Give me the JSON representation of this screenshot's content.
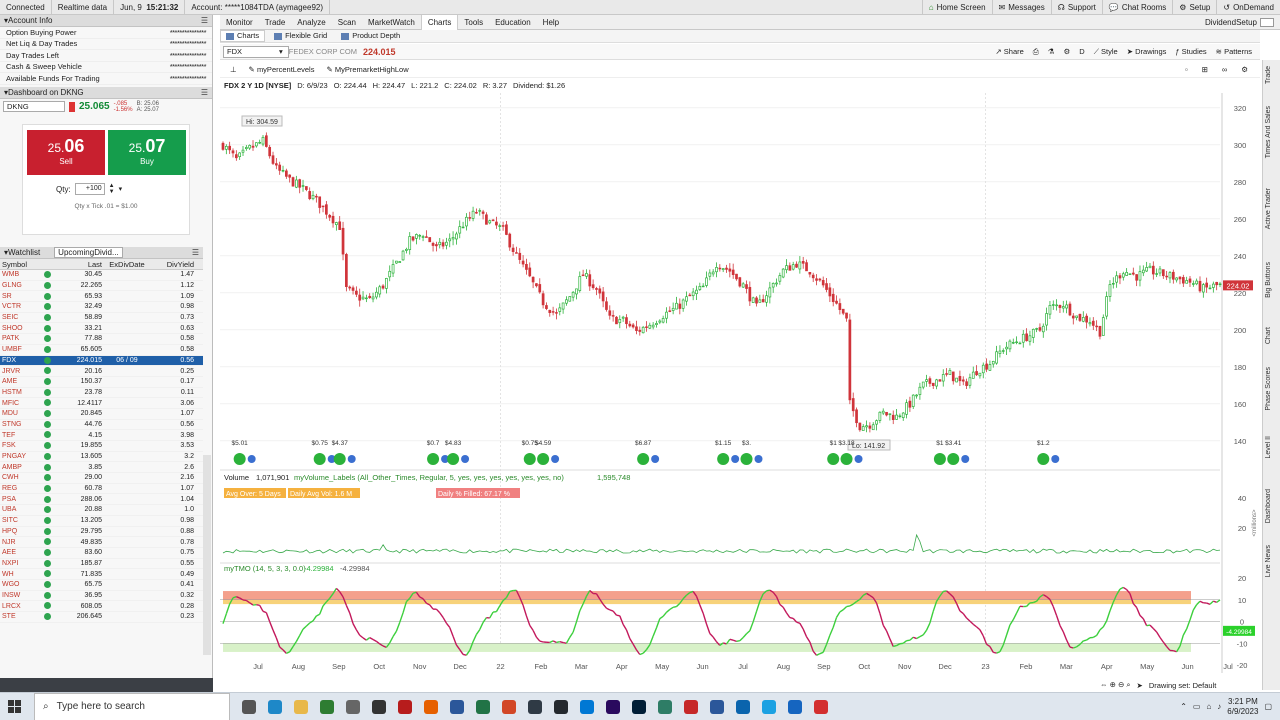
{
  "status": {
    "connected": "Connected",
    "realtime": "Realtime data",
    "date": "Jun, 9",
    "time": "15:21:32",
    "account_label": "Account:",
    "account": "*****1084TDA (aymagee92)",
    "home_screen": "Home Screen",
    "messages": "Messages",
    "support": "Support",
    "chat_rooms": "Chat Rooms",
    "setup": "Setup",
    "ondemand": "OnDemand"
  },
  "account_info": {
    "title": "Account Info",
    "rows": [
      {
        "label": "Option Buying Power",
        "value": "***************"
      },
      {
        "label": "Net Liq & Day Trades",
        "value": "***************"
      },
      {
        "label": "Day Trades Left",
        "value": "***************"
      },
      {
        "label": "Cash & Sweep Vehicle",
        "value": "***************"
      },
      {
        "label": "Available Funds For Trading",
        "value": "***************"
      }
    ]
  },
  "dashboard": {
    "title": "Dashboard on DKNG",
    "symbol": "DKNG",
    "last": "25.065",
    "change1": "-.085",
    "change2": "-1.56%",
    "bid_ask1": "B: 25.06",
    "bid_ask2": "A: 25.07",
    "sell_prefix": "25.",
    "sell_suffix": "06",
    "sell_label": "Sell",
    "buy_prefix": "25.",
    "buy_suffix": "07",
    "buy_label": "Buy",
    "qty_label": "Qty:",
    "qty_value": "+100",
    "tick_note": "Qty x Tick .01 = $1.00",
    "sell_color": "#c8202f",
    "buy_color": "#159d4c"
  },
  "watchlist": {
    "title": "Watchlist",
    "list_name": "UpcomingDivid...",
    "headers": {
      "symbol": "Symbol",
      "last": "Last",
      "exdiv": "ExDivDate",
      "divyield": "DivYield"
    },
    "rows": [
      {
        "symbol": "WMB",
        "last": "30.45",
        "exdiv": "",
        "divyield": "1.47"
      },
      {
        "symbol": "GLNG",
        "last": "22.265",
        "exdiv": "",
        "divyield": "1.12"
      },
      {
        "symbol": "SR",
        "last": "65.93",
        "exdiv": "",
        "divyield": "1.09"
      },
      {
        "symbol": "VCTR",
        "last": "32.49",
        "exdiv": "",
        "divyield": "0.98"
      },
      {
        "symbol": "SEIC",
        "last": "58.89",
        "exdiv": "",
        "divyield": "0.73"
      },
      {
        "symbol": "SHOO",
        "last": "33.21",
        "exdiv": "",
        "divyield": "0.63"
      },
      {
        "symbol": "PATK",
        "last": "77.88",
        "exdiv": "",
        "divyield": "0.58"
      },
      {
        "symbol": "UMBF",
        "last": "65.605",
        "exdiv": "",
        "divyield": "0.58"
      },
      {
        "symbol": "FDX",
        "last": "224.015",
        "exdiv": "06 / 09",
        "divyield": "0.56"
      },
      {
        "symbol": "JRVR",
        "last": "20.16",
        "exdiv": "",
        "divyield": "0.25"
      },
      {
        "symbol": "AME",
        "last": "150.37",
        "exdiv": "",
        "divyield": "0.17"
      },
      {
        "symbol": "HSTM",
        "last": "23.78",
        "exdiv": "",
        "divyield": "0.11"
      },
      {
        "symbol": "MFIC",
        "last": "12.4117",
        "exdiv": "",
        "divyield": "3.06"
      },
      {
        "symbol": "MDU",
        "last": "20.845",
        "exdiv": "",
        "divyield": "1.07"
      },
      {
        "symbol": "STNG",
        "last": "44.76",
        "exdiv": "",
        "divyield": "0.56"
      },
      {
        "symbol": "TEF",
        "last": "4.15",
        "exdiv": "",
        "divyield": "3.98"
      },
      {
        "symbol": "FSK",
        "last": "19.855",
        "exdiv": "",
        "divyield": "3.53"
      },
      {
        "symbol": "PNGAY",
        "last": "13.605",
        "exdiv": "",
        "divyield": "3.2"
      },
      {
        "symbol": "AMBP",
        "last": "3.85",
        "exdiv": "",
        "divyield": "2.6"
      },
      {
        "symbol": "CWH",
        "last": "29.00",
        "exdiv": "",
        "divyield": "2.16"
      },
      {
        "symbol": "REG",
        "last": "60.78",
        "exdiv": "",
        "divyield": "1.07"
      },
      {
        "symbol": "PSA",
        "last": "288.06",
        "exdiv": "",
        "divyield": "1.04"
      },
      {
        "symbol": "UBA",
        "last": "20.88",
        "exdiv": "",
        "divyield": "1.0"
      },
      {
        "symbol": "SITC",
        "last": "13.205",
        "exdiv": "",
        "divyield": "0.98"
      },
      {
        "symbol": "HPQ",
        "last": "29.795",
        "exdiv": "",
        "divyield": "0.88"
      },
      {
        "symbol": "NJR",
        "last": "49.835",
        "exdiv": "",
        "divyield": "0.78"
      },
      {
        "symbol": "AEE",
        "last": "83.60",
        "exdiv": "",
        "divyield": "0.75"
      },
      {
        "symbol": "NXPI",
        "last": "185.87",
        "exdiv": "",
        "divyield": "0.55"
      },
      {
        "symbol": "WH",
        "last": "71.835",
        "exdiv": "",
        "divyield": "0.49"
      },
      {
        "symbol": "WGO",
        "last": "65.75",
        "exdiv": "",
        "divyield": "0.41"
      },
      {
        "symbol": "INSW",
        "last": "36.95",
        "exdiv": "",
        "divyield": "0.32"
      },
      {
        "symbol": "LRCX",
        "last": "608.05",
        "exdiv": "",
        "divyield": "0.28"
      },
      {
        "symbol": "STE",
        "last": "206.645",
        "exdiv": "",
        "divyield": "0.23"
      }
    ]
  },
  "nav": {
    "tabs": [
      "Monitor",
      "Trade",
      "Analyze",
      "Scan",
      "MarketWatch",
      "Charts",
      "Tools",
      "Education",
      "Help"
    ],
    "active": "Charts",
    "right_label": "DividendSetup"
  },
  "subtabs": [
    "Charts",
    "Flexible Grid",
    "Product Depth"
  ],
  "chart_toolbar": {
    "symbol": "FDX",
    "company": "FEDEX CORP COM",
    "last": "224.015",
    "share": "Share",
    "style": "Style",
    "drawings": "Drawings",
    "studies": "Studies",
    "patterns": "Patterns"
  },
  "study_bar": {
    "item1": "myPercentLevels",
    "item2": "MyPremarketHighLow"
  },
  "ohlc": {
    "title": "FDX 2 Y 1D [NYSE]",
    "date": "D: 6/9/23",
    "open": "O: 224.44",
    "high": "H: 224.47",
    "low": "L: 221.2",
    "close": "C: 224.02",
    "range": "R: 3.27",
    "dividend": "Dividend: $1.26"
  },
  "chart_data": {
    "type": "candlestick",
    "price_axis": {
      "ticks": [
        140,
        160,
        180,
        200,
        220,
        240,
        260,
        280,
        300,
        320
      ],
      "range": [
        128,
        328
      ]
    },
    "months": [
      "Jul",
      "Aug",
      "Sep",
      "Oct",
      "Nov",
      "Dec",
      "22",
      "Feb",
      "Mar",
      "Apr",
      "May",
      "Jun",
      "Jul",
      "Aug",
      "Sep",
      "Oct",
      "Nov",
      "Dec",
      "23",
      "Feb",
      "Mar",
      "Apr",
      "May",
      "Jun",
      "Jul"
    ],
    "close_path": [
      [
        0,
        300
      ],
      [
        4,
        292
      ],
      [
        8,
        298
      ],
      [
        12,
        302
      ],
      [
        16,
        287
      ],
      [
        20,
        281
      ],
      [
        24,
        276
      ],
      [
        28,
        270
      ],
      [
        32,
        262
      ],
      [
        35,
        256
      ],
      [
        37,
        222
      ],
      [
        40,
        218
      ],
      [
        44,
        216
      ],
      [
        48,
        224
      ],
      [
        52,
        236
      ],
      [
        56,
        248
      ],
      [
        60,
        252
      ],
      [
        64,
        244
      ],
      [
        68,
        248
      ],
      [
        72,
        257
      ],
      [
        76,
        264
      ],
      [
        80,
        258
      ],
      [
        84,
        254
      ],
      [
        88,
        240
      ],
      [
        92,
        228
      ],
      [
        96,
        215
      ],
      [
        100,
        208
      ],
      [
        104,
        218
      ],
      [
        108,
        230
      ],
      [
        112,
        222
      ],
      [
        116,
        206
      ],
      [
        120,
        205
      ],
      [
        124,
        199
      ],
      [
        128,
        203
      ],
      [
        132,
        208
      ],
      [
        136,
        212
      ],
      [
        140,
        218
      ],
      [
        144,
        223
      ],
      [
        148,
        236
      ],
      [
        152,
        232
      ],
      [
        156,
        224
      ],
      [
        160,
        212
      ],
      [
        164,
        222
      ],
      [
        168,
        232
      ],
      [
        172,
        236
      ],
      [
        176,
        232
      ],
      [
        180,
        224
      ],
      [
        184,
        214
      ],
      [
        187,
        205
      ],
      [
        188,
        160
      ],
      [
        191,
        148
      ],
      [
        194,
        149
      ],
      [
        198,
        155
      ],
      [
        202,
        153
      ],
      [
        206,
        160
      ],
      [
        210,
        170
      ],
      [
        214,
        173
      ],
      [
        218,
        176
      ],
      [
        222,
        170
      ],
      [
        226,
        178
      ],
      [
        230,
        182
      ],
      [
        234,
        190
      ],
      [
        238,
        194
      ],
      [
        242,
        197
      ],
      [
        245,
        200
      ],
      [
        248,
        212
      ],
      [
        252,
        214
      ],
      [
        256,
        207
      ],
      [
        260,
        205
      ],
      [
        263,
        199
      ],
      [
        266,
        224
      ],
      [
        270,
        232
      ],
      [
        274,
        229
      ],
      [
        278,
        232
      ],
      [
        282,
        230
      ],
      [
        286,
        228
      ],
      [
        290,
        226
      ],
      [
        294,
        222
      ],
      [
        298,
        224
      ]
    ],
    "hi_label": "Hi: 304.59",
    "lo_label": "Lo: 141.92",
    "last_label": "224.02",
    "dividends": [
      {
        "i": 5,
        "label": "$5.01"
      },
      {
        "i": 29,
        "label": "$0.75"
      },
      {
        "i": 35,
        "label": "$4.37"
      },
      {
        "i": 63,
        "label": "$0.7"
      },
      {
        "i": 69,
        "label": "$4.83"
      },
      {
        "i": 92,
        "label": "$0.75"
      },
      {
        "i": 96,
        "label": "$4.59"
      },
      {
        "i": 126,
        "label": "$6.87"
      },
      {
        "i": 150,
        "label": "$1.15"
      },
      {
        "i": 157,
        "label": "$3."
      },
      {
        "i": 183,
        "label": "$1"
      },
      {
        "i": 187,
        "label": "$3.18"
      },
      {
        "i": 215,
        "label": "$1"
      },
      {
        "i": 219,
        "label": "$3.41"
      },
      {
        "i": 246,
        "label": "$1.2"
      }
    ],
    "volume_label": "Volume",
    "volume_value": "1,071,901",
    "volume_study": "myVolume_Labels (All_Other_Times, Regular, 5, yes, yes, yes, yes, yes, yes, no)",
    "volume_study_value": "1,595,748",
    "vol_tag1": "Avg Over: 5 Days",
    "vol_tag2": "Daily Avg Vol: 1.6 M",
    "vol_tag3": "Daily % Filled: 67.17 %",
    "volume_axis": {
      "ticks": [
        20,
        40
      ],
      "unit": "<millions>"
    },
    "osc_label": "myTMO (14, 5, 3, 3, 0.0)",
    "osc_value1": "-4.29984",
    "osc_value2": "-4.29984",
    "osc_axis": {
      "ticks": [
        -20,
        -10,
        0,
        10,
        20
      ]
    },
    "osc_last": "-4.29984"
  },
  "right_strip": [
    "Trade",
    "Times And Sales",
    "Active Trader",
    "Big Buttons",
    "Chart",
    "Phase Scores",
    "Level II",
    "Dashboard",
    "Live News"
  ],
  "chart_footer": {
    "drawing_set": "Drawing set: Default"
  },
  "taskbar": {
    "search_placeholder": "Type here to search",
    "time": "3:21 PM",
    "date": "6/9/2023"
  }
}
